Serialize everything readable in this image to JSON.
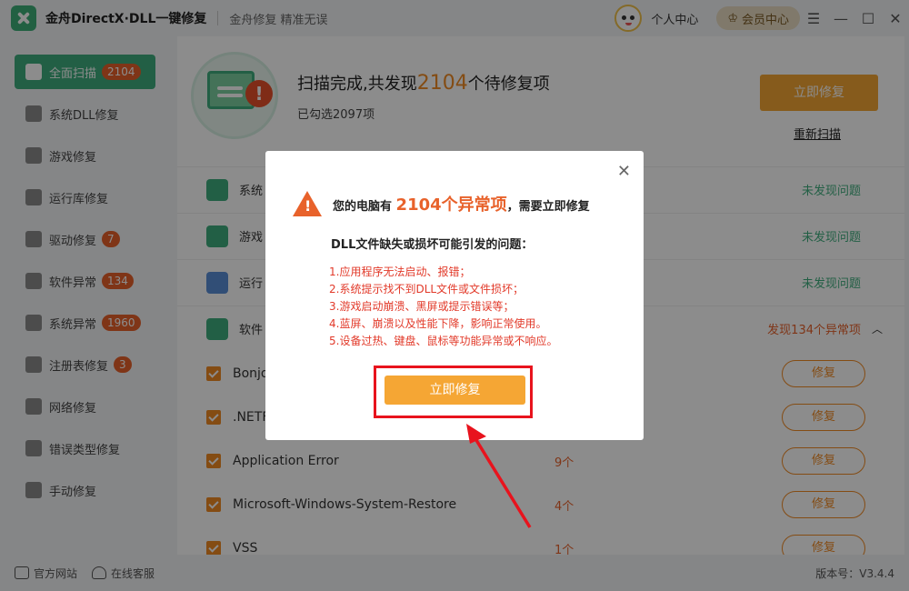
{
  "app": {
    "title": "金舟DirectX·DLL一键修复",
    "slogan": "金舟修复 精准无误",
    "user_center": "个人中心",
    "vip_center": "会员中心",
    "icons": {
      "logo": "tools-icon",
      "avatar": "panda-avatar",
      "menu": "menu-icon",
      "min": "minimize-icon",
      "max": "maximize-icon",
      "close": "close-icon"
    },
    "window_controls": {
      "menu": "☰",
      "min": "—",
      "max": "☐",
      "close": "✕"
    }
  },
  "sidebar": {
    "items": [
      {
        "label": "全面扫描",
        "badge": "2104",
        "active": true,
        "icon": "scan-icon"
      },
      {
        "label": "系统DLL修复",
        "badge": "",
        "icon": "dll-icon"
      },
      {
        "label": "游戏修复",
        "badge": "",
        "icon": "gamepad-icon"
      },
      {
        "label": "运行库修复",
        "badge": "",
        "icon": "runtime-icon"
      },
      {
        "label": "驱动修复",
        "badge": "7",
        "icon": "driver-icon"
      },
      {
        "label": "软件异常",
        "badge": "134",
        "icon": "software-icon"
      },
      {
        "label": "系统异常",
        "badge": "1960",
        "icon": "system-gear-icon"
      },
      {
        "label": "注册表修复",
        "badge": "3",
        "icon": "registry-icon"
      },
      {
        "label": "网络修复",
        "badge": "",
        "icon": "wifi-icon"
      },
      {
        "label": "错误类型修复",
        "badge": "",
        "icon": "warning-icon"
      },
      {
        "label": "手动修复",
        "badge": "",
        "icon": "wrench-icon"
      }
    ]
  },
  "footer": {
    "official_site": "官方网站",
    "online_service": "在线客服",
    "version": "版本号：V3.4.4"
  },
  "hero": {
    "title_prefix": "扫描完成,共发现",
    "count": "2104",
    "title_suffix": "个待修复项",
    "selected": "已勾选2097项",
    "fix_button": "立即修复",
    "rescan": "重新扫描"
  },
  "categories": [
    {
      "label": "系统",
      "status": "未发现问题"
    },
    {
      "label": "游戏",
      "status": "未发现问题"
    },
    {
      "label": "运行",
      "status": "未发现问题"
    },
    {
      "label": "软件",
      "status": "发现134个异常项"
    }
  ],
  "items": [
    {
      "name": "Bonjo",
      "count": "",
      "action": "修复"
    },
    {
      "name": ".NETF",
      "count": "",
      "action": "修复"
    },
    {
      "name": "Application Error",
      "count": "9个",
      "action": "修复"
    },
    {
      "name": "Microsoft-Windows-System-Restore",
      "count": "4个",
      "action": "修复"
    },
    {
      "name": "VSS",
      "count": "1个",
      "action": "修复"
    }
  ],
  "dialog": {
    "head_prefix": "您的电脑有",
    "head_count": "2104个异常项",
    "head_suffix": "，需要立即修复",
    "subtitle": "DLL文件缺失或损坏可能引发的问题：",
    "problems": [
      "1.应用程序无法启动、报错；",
      "2.系统提示找不到DLL文件或文件损坏；",
      "3.游戏启动崩溃、黑屏或提示错误等；",
      "4.蓝屏、崩溃以及性能下降，影响正常使用。",
      "5.设备过热、键盘、鼠标等功能异常或不响应。"
    ],
    "fix_button": "立即修复",
    "close": "✕"
  }
}
